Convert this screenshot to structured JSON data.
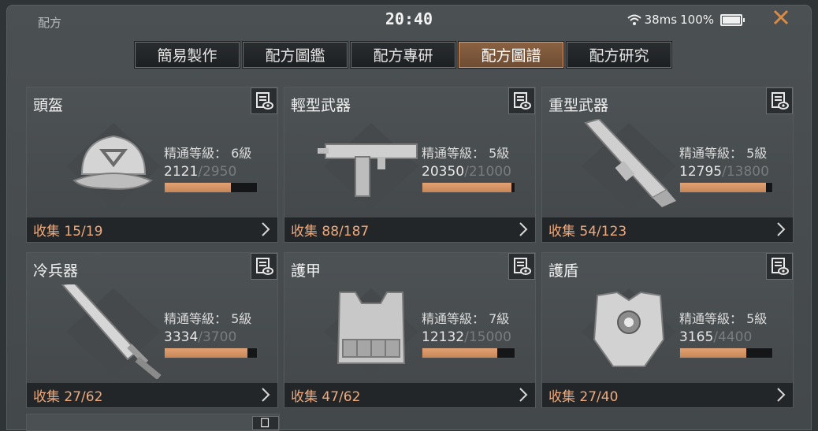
{
  "status": {
    "app_title": "配方",
    "time": "20:40",
    "ping": "38ms",
    "battery": "100%"
  },
  "tabs": [
    {
      "label": "簡易製作",
      "active": false
    },
    {
      "label": "配方圖鑑",
      "active": false
    },
    {
      "label": "配方專研",
      "active": false
    },
    {
      "label": "配方圖譜",
      "active": true
    },
    {
      "label": "配方研究",
      "active": false
    }
  ],
  "cards": [
    {
      "title": "頭盔",
      "level": "精通等級： 6級",
      "xp": "2121",
      "xp_max": "/2950",
      "progress": 0.72,
      "collect": "收集 15/19",
      "icon": "helmet-cap-icon"
    },
    {
      "title": "輕型武器",
      "level": "精通等級： 5級",
      "xp": "20350",
      "xp_max": "/21000",
      "progress": 0.97,
      "collect": "收集 88/187",
      "icon": "smg-icon"
    },
    {
      "title": "重型武器",
      "level": "精通等級： 5級",
      "xp": "12795",
      "xp_max": "/13800",
      "progress": 0.93,
      "collect": "收集 54/123",
      "icon": "launcher-icon"
    },
    {
      "title": "冷兵器",
      "level": "精通等級： 5級",
      "xp": "3334",
      "xp_max": "/3700",
      "progress": 0.9,
      "collect": "收集 27/62",
      "icon": "blade-icon"
    },
    {
      "title": "護甲",
      "level": "精通等級： 7級",
      "xp": "12132",
      "xp_max": "/15000",
      "progress": 0.81,
      "collect": "收集 47/62",
      "icon": "vest-icon"
    },
    {
      "title": "護盾",
      "level": "精通等級： 5級",
      "xp": "3165",
      "xp_max": "/4400",
      "progress": 0.72,
      "collect": "收集 27/40",
      "icon": "shield-armor-icon"
    }
  ],
  "colors": {
    "accent": "#e5a06a",
    "bar_fill": "#d4956a",
    "collect_text": "#f0a97b"
  }
}
